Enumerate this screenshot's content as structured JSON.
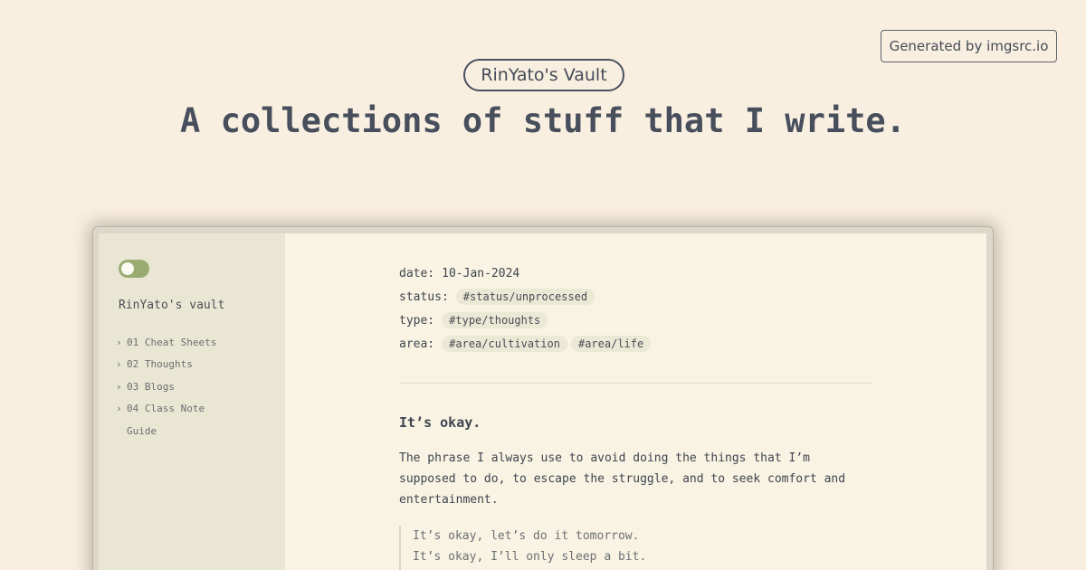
{
  "badge": "Generated by imgsrc.io",
  "hero": {
    "vault_pill": "RinYato's Vault",
    "headline": "A collections of stuff that I write."
  },
  "sidebar": {
    "toggle_on": true,
    "title": "RinYato's vault",
    "items": [
      {
        "label": "01 Cheat Sheets",
        "folder": true,
        "icon": "chevron-right-icon"
      },
      {
        "label": "02 Thoughts",
        "folder": true,
        "icon": "chevron-right-icon"
      },
      {
        "label": "03 Blogs",
        "folder": true,
        "icon": "chevron-right-icon"
      },
      {
        "label": "04 Class Note",
        "folder": true,
        "icon": "chevron-right-icon"
      },
      {
        "label": "Guide",
        "folder": false
      }
    ]
  },
  "note": {
    "meta": {
      "date_key": "date:",
      "date_value": "10-Jan-2024",
      "status_key": "status:",
      "status_tags": [
        "#status/unprocessed"
      ],
      "type_key": "type:",
      "type_tags": [
        "#type/thoughts"
      ],
      "area_key": "area:",
      "area_tags": [
        "#area/cultivation",
        "#area/life"
      ]
    },
    "title": "It’s okay.",
    "paragraph_lines": [
      "The phrase I always use to avoid doing the things that I’m",
      "supposed to do, to escape the struggle, and to seek comfort and",
      "entertainment."
    ],
    "quote_lines": [
      "It’s okay, let’s do it tomorrow.",
      "It’s okay, I’ll only sleep a bit."
    ]
  },
  "colors": {
    "page_bg": "#f9efe1",
    "sidebar_bg": "#e9e7d3",
    "content_bg": "#f8f3e2",
    "toggle_accent": "#9aab72",
    "tag_bg": "#ebe8d6",
    "text": "#475060"
  }
}
